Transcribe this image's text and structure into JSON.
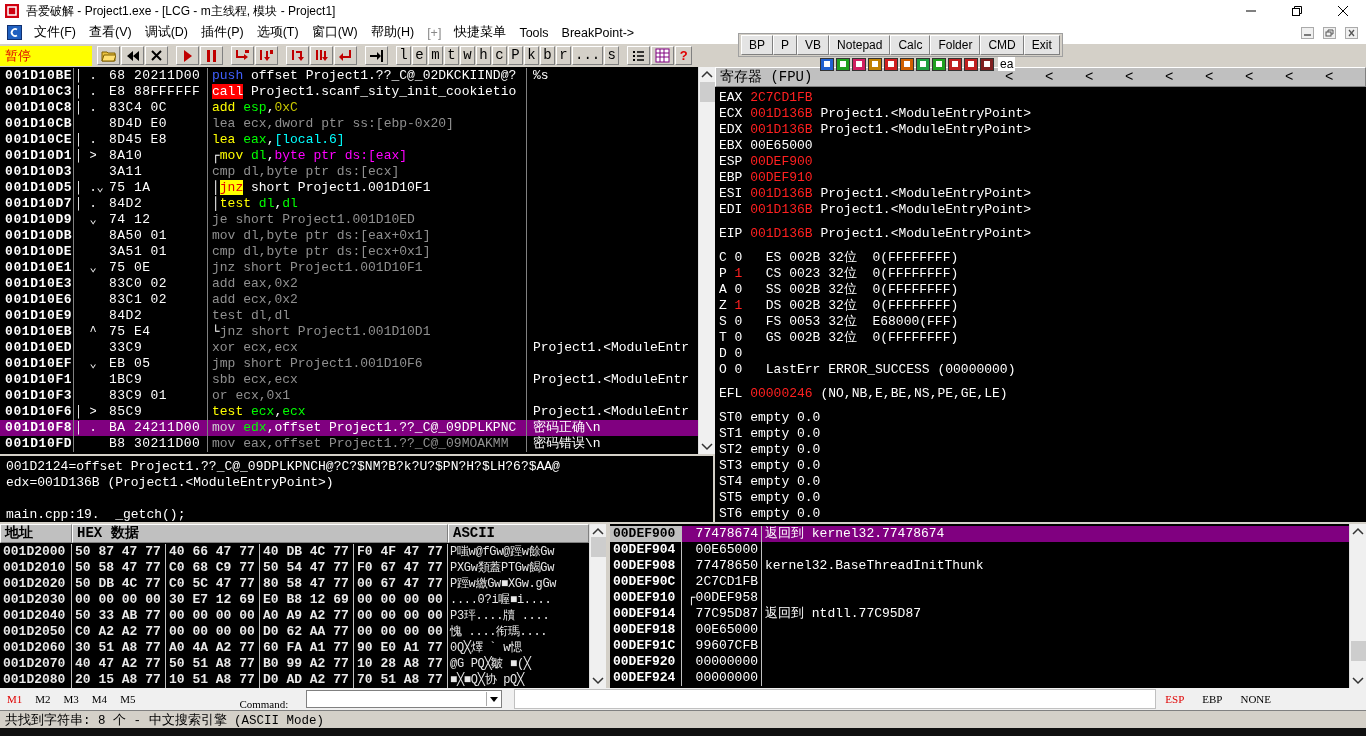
{
  "window": {
    "title": "吾爱破解 - Project1.exe - [LCG - m主线程, 模块 - Project1]"
  },
  "menu": [
    "文件(F)",
    "查看(V)",
    "调试(D)",
    "插件(P)",
    "选项(T)",
    "窗口(W)",
    "帮助(H)",
    "[+]",
    "快捷菜单",
    "Tools",
    "BreakPoint->"
  ],
  "toolbar": {
    "status": "暂停",
    "letters": [
      "l",
      "e",
      "m",
      "t",
      "w",
      "h",
      "c",
      "P",
      "k",
      "b",
      "r",
      "...",
      "s"
    ],
    "help": "?"
  },
  "quick_toolbar": {
    "buttons": [
      "BP",
      "P",
      "VB",
      "Notepad",
      "Calc",
      "Folder",
      "CMD",
      "Exit"
    ],
    "tail_text": "ea"
  },
  "disassembly": {
    "rows": [
      {
        "address": "001D10BE",
        "marker": "│ .",
        "hex": "68 20211D00",
        "instr": [
          {
            "t": "push",
            "kind": "push"
          },
          {
            "t": " offset Project1.??_C@_02DKCKIIND@?",
            "kind": "text"
          }
        ],
        "comment": "%s",
        "selected": false
      },
      {
        "address": "001D10C3",
        "marker": "│ .",
        "hex": "E8 88FFFFFF",
        "instr": [
          {
            "t": "call",
            "kind": "call"
          },
          {
            "t": " Project1.scanf_sity_init_cookietio",
            "kind": "text"
          }
        ],
        "selected": false
      },
      {
        "address": "001D10C8",
        "marker": "│ .",
        "hex": "83C4 0C",
        "instr": [
          {
            "t": "add ",
            "kind": "mn"
          },
          {
            "t": "esp",
            "kind": "reg"
          },
          {
            "t": ",",
            "kind": "text"
          },
          {
            "t": "0xC",
            "kind": "imm"
          }
        ],
        "selected": false
      },
      {
        "address": "001D10CB",
        "hex": "8D4D E0",
        "instr": [
          {
            "t": "lea ecx,dword ptr ss:[ebp-0x20]",
            "kind": "gray"
          }
        ],
        "selected": false
      },
      {
        "address": "001D10CE",
        "marker": "│ .",
        "hex": "8D45 E8",
        "instr": [
          {
            "t": "lea ",
            "kind": "mn"
          },
          {
            "t": "eax",
            "kind": "reg"
          },
          {
            "t": ",",
            "kind": "text"
          },
          {
            "t": "[local.6]",
            "kind": "mem"
          }
        ],
        "selected": false
      },
      {
        "address": "001D10D1",
        "marker": "│ >",
        "hex": "8A10",
        "instr": [
          {
            "t": "┌",
            "kind": "text"
          },
          {
            "t": "mov ",
            "kind": "mn"
          },
          {
            "t": "dl",
            "kind": "reg"
          },
          {
            "t": ",",
            "kind": "text"
          },
          {
            "t": "byte ptr ds:[eax]",
            "kind": "ptr"
          }
        ],
        "selected": false
      },
      {
        "address": "001D10D3",
        "hex": "3A11",
        "instr": [
          {
            "t": "cmp dl,byte ptr ds:[ecx]",
            "kind": "gray"
          }
        ],
        "selected": false
      },
      {
        "address": "001D10D5",
        "marker": "│ .⌄",
        "hex": "75 1A",
        "instr": [
          {
            "t": "│",
            "kind": "text"
          },
          {
            "t": "jnz",
            "kind": "jcc"
          },
          {
            "t": " short Project1.001D10F1",
            "kind": "text"
          }
        ],
        "selected": false
      },
      {
        "address": "001D10D7",
        "marker": "│ .",
        "hex": "84D2",
        "instr": [
          {
            "t": "│",
            "kind": "text"
          },
          {
            "t": "test ",
            "kind": "mn"
          },
          {
            "t": "dl",
            "kind": "reg"
          },
          {
            "t": ",",
            "kind": "text"
          },
          {
            "t": "dl",
            "kind": "reg"
          }
        ],
        "selected": false
      },
      {
        "address": "001D10D9",
        "marker": "  ⌄",
        "hex": "74 12",
        "instr": [
          {
            "t": "je short Project1.001D10ED",
            "kind": "gray"
          }
        ],
        "selected": false
      },
      {
        "address": "001D10DB",
        "hex": "8A50 01",
        "instr": [
          {
            "t": "mov dl,byte ptr ds:[eax+0x1]",
            "kind": "gray"
          }
        ],
        "selected": false
      },
      {
        "address": "001D10DE",
        "hex": "3A51 01",
        "instr": [
          {
            "t": "cmp dl,byte ptr ds:[ecx+0x1]",
            "kind": "gray"
          }
        ],
        "selected": false
      },
      {
        "address": "001D10E1",
        "marker": "  ⌄",
        "hex": "75 0E",
        "instr": [
          {
            "t": "jnz short Project1.001D10F1",
            "kind": "gray"
          }
        ],
        "selected": false
      },
      {
        "address": "001D10E3",
        "hex": "83C0 02",
        "instr": [
          {
            "t": "add eax,0x2",
            "kind": "gray"
          }
        ],
        "selected": false
      },
      {
        "address": "001D10E6",
        "hex": "83C1 02",
        "instr": [
          {
            "t": "add ecx,0x2",
            "kind": "gray"
          }
        ],
        "selected": false
      },
      {
        "address": "001D10E9",
        "hex": "84D2",
        "instr": [
          {
            "t": "test dl,dl",
            "kind": "gray"
          }
        ],
        "selected": false
      },
      {
        "address": "001D10EB",
        "marker": "  ^",
        "hex": "75 E4",
        "instr": [
          {
            "t": "└",
            "kind": "text"
          },
          {
            "t": "jnz short Project1.001D10D1",
            "kind": "gray"
          }
        ],
        "selected": false
      },
      {
        "address": "001D10ED",
        "hex": "33C9",
        "instr": [
          {
            "t": "xor ecx,ecx",
            "kind": "gray"
          }
        ],
        "comment": "Project1.<ModuleEntr",
        "selected": false
      },
      {
        "address": "001D10EF",
        "marker": "  ⌄",
        "hex": "EB 05",
        "instr": [
          {
            "t": "jmp short Project1.001D10F6",
            "kind": "gray"
          }
        ],
        "selected": false
      },
      {
        "address": "001D10F1",
        "hex": "1BC9",
        "instr": [
          {
            "t": "sbb ecx,ecx",
            "kind": "gray"
          }
        ],
        "comment": "Project1.<ModuleEntr",
        "selected": false
      },
      {
        "address": "001D10F3",
        "hex": "83C9 01",
        "instr": [
          {
            "t": "or ecx,0x1",
            "kind": "gray"
          }
        ],
        "selected": false
      },
      {
        "address": "001D10F6",
        "marker": "│ >",
        "hex": "85C9",
        "instr": [
          {
            "t": "test ",
            "kind": "mn"
          },
          {
            "t": "ecx",
            "kind": "reg"
          },
          {
            "t": ",",
            "kind": "text"
          },
          {
            "t": "ecx",
            "kind": "reg"
          }
        ],
        "comment": "Project1.<ModuleEntr",
        "selected": false
      },
      {
        "address": "001D10F8",
        "marker": "│ .",
        "hex": "BA 24211D00",
        "instr": [
          {
            "t": "mov ",
            "kind": "selmn"
          },
          {
            "t": "edx",
            "kind": "reg"
          },
          {
            "t": ",offset Project1.??_C@_09DPLKPNC",
            "kind": "text"
          }
        ],
        "comment": "密码正确\\n",
        "selected": true
      },
      {
        "address": "001D10FD",
        "hex": "B8 30211D00",
        "instr": [
          {
            "t": "mov eax,offset Project1.??_C@_09MOAKMM",
            "kind": "gray"
          }
        ],
        "comment": "密码错误\\n",
        "selected": false
      }
    ]
  },
  "info": [
    [
      "001D2124=offset Project1.??_C@_09DPLKPNCH@?C?$NM?B?k?U?$PN?H?$LH?6?$AA@",
      "edx=001D136B (Project1.<ModuleEntryPoint>)"
    ],
    [
      "main.cpp:19.  _getch();"
    ]
  ],
  "registers": {
    "title": "寄存器 (FPU)",
    "header_buttons": [
      "<",
      "<",
      "<",
      "<",
      "<",
      "<",
      "<",
      "<",
      "<"
    ],
    "groups": [
      [
        {
          "kind": "reg",
          "label": "EAX",
          "value": "2C7CD1FB",
          "changed": true
        },
        {
          "kind": "reg",
          "label": "ECX",
          "value": "001D136B",
          "changed": true,
          "comment": "Project1.<ModuleEntryPoint>"
        },
        {
          "kind": "reg",
          "label": "EDX",
          "value": "001D136B",
          "changed": true,
          "comment": "Project1.<ModuleEntryPoint>"
        },
        {
          "kind": "reg",
          "label": "EBX",
          "value": "00E65000",
          "changed": false
        },
        {
          "kind": "reg",
          "label": "ESP",
          "value": "00DEF900",
          "changed": true
        },
        {
          "kind": "reg",
          "label": "EBP",
          "value": "00DEF910",
          "changed": true
        },
        {
          "kind": "reg",
          "label": "ESI",
          "value": "001D136B",
          "changed": true,
          "comment": "Project1.<ModuleEntryPoint>"
        },
        {
          "kind": "reg",
          "label": "EDI",
          "value": "001D136B",
          "changed": true,
          "comment": "Project1.<ModuleEntryPoint>"
        }
      ],
      [
        {
          "kind": "reg",
          "label": "EIP",
          "value": "001D136B",
          "changed": true,
          "comment": "Project1.<ModuleEntryPoint>"
        }
      ],
      [
        {
          "kind": "flag",
          "label": "C",
          "value": "0",
          "changed": false,
          "comment": "ES 002B 32位  0(FFFFFFFF)"
        },
        {
          "kind": "flag",
          "label": "P",
          "value": "1",
          "changed": true,
          "comment": "CS 0023 32位  0(FFFFFFFF)"
        },
        {
          "kind": "flag",
          "label": "A",
          "value": "0",
          "changed": false,
          "comment": "SS 002B 32位  0(FFFFFFFF)"
        },
        {
          "kind": "flag",
          "label": "Z",
          "value": "1",
          "changed": true,
          "comment": "DS 002B 32位  0(FFFFFFFF)"
        },
        {
          "kind": "flag",
          "label": "S",
          "value": "0",
          "changed": false,
          "comment": "FS 0053 32位  E68000(FFF)"
        },
        {
          "kind": "flag",
          "label": "T",
          "value": "0",
          "changed": false,
          "comment": "GS 002B 32位  0(FFFFFFFF)"
        },
        {
          "kind": "flag",
          "label": "D",
          "value": "0",
          "changed": false
        },
        {
          "kind": "flag",
          "label": "O",
          "value": "0",
          "changed": false,
          "comment": "LastErr ERROR_SUCCESS (00000000)"
        }
      ],
      [
        {
          "kind": "reg",
          "label": "EFL",
          "value": "00000246",
          "changed": true,
          "comment": "(NO,NB,E,BE,NS,PE,GE,LE)"
        }
      ],
      [
        {
          "kind": "fpu",
          "label": "ST0",
          "value": "empty",
          "changed": false,
          "comment": "0.0"
        },
        {
          "kind": "fpu",
          "label": "ST1",
          "value": "empty",
          "changed": false,
          "comment": "0.0"
        },
        {
          "kind": "fpu",
          "label": "ST2",
          "value": "empty",
          "changed": false,
          "comment": "0.0"
        },
        {
          "kind": "fpu",
          "label": "ST3",
          "value": "empty",
          "changed": false,
          "comment": "0.0"
        },
        {
          "kind": "fpu",
          "label": "ST4",
          "value": "empty",
          "changed": false,
          "comment": "0.0"
        },
        {
          "kind": "fpu",
          "label": "ST5",
          "value": "empty",
          "changed": false,
          "comment": "0.0"
        },
        {
          "kind": "fpu",
          "label": "ST6",
          "value": "empty",
          "changed": false,
          "comment": "0.0"
        }
      ]
    ]
  },
  "dump": {
    "columns": [
      "地址",
      "HEX 数据",
      "ASCII"
    ],
    "rows": [
      {
        "address": "001D2000",
        "hex": [
          "50 87 47 77",
          "40 66 47 77",
          "40 DB 4C 77",
          "F0 4F 47 77"
        ],
        "ascii": "P嗤w@fGw@踁w餘Gw"
      },
      {
        "address": "001D2010",
        "hex": [
          "50 58 47 77",
          "C0 68 C9 77",
          "50 54 47 77",
          "F0 67 47 77"
        ],
        "ascii": "PXGw類蓋PTGw餲Gw"
      },
      {
        "address": "001D2020",
        "hex": [
          "50 DB 4C 77",
          "C0 5C 47 77",
          "80 58 47 77",
          "00 67 47 77"
        ],
        "ascii": "P踁w繳Gw■XGw.gGw"
      },
      {
        "address": "001D2030",
        "hex": [
          "00 00 00 00",
          "30 E7 12 69",
          "E0 B8 12 69",
          "00 00 00 00"
        ],
        "ascii": "....0?i喔■i...."
      },
      {
        "address": "001D2040",
        "hex": [
          "50 33 AB 77",
          "00 00 00 00",
          "A0 A9 A2 77",
          "00 00 00 00"
        ],
        "ascii": "P3玶....牘 ...."
      },
      {
        "address": "001D2050",
        "hex": [
          "C0 A2 A2 77",
          "00 00 00 00",
          "D0 62 AA 77",
          "00 00 00 00"
        ],
        "ascii": "愧 ....衔瑪...."
      },
      {
        "address": "001D2060",
        "hex": [
          "30 51 A8 77",
          "A0 4A A2 77",
          "60 FA A1 77",
          "90 E0 A1 77"
        ],
        "ascii": "0Q╳燡 ` w愢"
      },
      {
        "address": "001D2070",
        "hex": [
          "40 47 A2 77",
          "50 51 A8 77",
          "B0 99 A2 77",
          "10 28 A8 77"
        ],
        "ascii": "@G PQ╳皺 ■(╳"
      },
      {
        "address": "001D2080",
        "hex": [
          "20 15 A8 77",
          "10 51 A8 77",
          "D0 AD A2 77",
          "70 51 A8 77"
        ],
        "ascii": "■╳■Q╳协 pQ╳"
      }
    ]
  },
  "stack": {
    "rows": [
      {
        "address": "00DEF900",
        "value": "77478674",
        "comment": "返回到 kernel32.77478674",
        "selected": true
      },
      {
        "address": "00DEF904",
        "value": "00E65000",
        "selected": false
      },
      {
        "address": "00DEF908",
        "value": "77478650",
        "comment": "kernel32.BaseThreadInitThunk",
        "selected": false
      },
      {
        "address": "00DEF90C",
        "value": "2C7CD1FB",
        "selected": false
      },
      {
        "address": "00DEF910",
        "value": "┌00DEF958",
        "selected": false
      },
      {
        "address": "00DEF914",
        "value": "77C95D87",
        "comment": "返回到 ntdll.77C95D87",
        "selected": false
      },
      {
        "address": "00DEF918",
        "value": "00E65000",
        "selected": false
      },
      {
        "address": "00DEF91C",
        "value": "99607CFB",
        "selected": false
      },
      {
        "address": "00DEF920",
        "value": "00000000",
        "selected": false
      },
      {
        "address": "00DEF924",
        "value": "00000000",
        "selected": false
      }
    ]
  },
  "command_bar": {
    "tabs": [
      {
        "label": "M1",
        "selected": true
      },
      {
        "label": "M2",
        "selected": false
      },
      {
        "label": "M3",
        "selected": false
      },
      {
        "label": "M4",
        "selected": false
      },
      {
        "label": "M5",
        "selected": false
      }
    ],
    "command_label": "Command:",
    "modes": [
      {
        "label": "ESP",
        "selected": true
      },
      {
        "label": "EBP",
        "selected": false
      },
      {
        "label": "NONE",
        "selected": false
      }
    ]
  },
  "status_bar": "共找到字符串: 8 个  -  中文搜索引擎 (ASCII Mode)"
}
